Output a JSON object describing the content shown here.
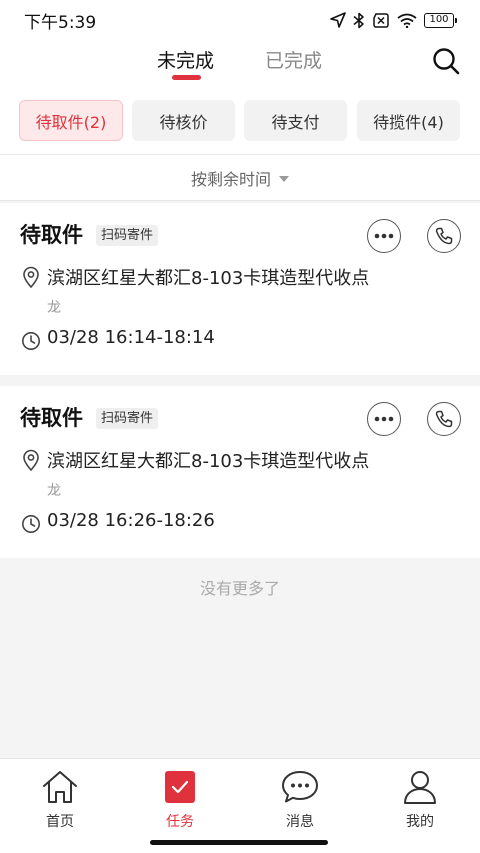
{
  "status_bar": {
    "time": "下午5:39",
    "battery": "100"
  },
  "header": {
    "tabs": [
      {
        "label": "未完成",
        "active": true
      },
      {
        "label": "已完成",
        "active": false
      }
    ]
  },
  "filters": [
    {
      "label": "待取件(2)",
      "active": true
    },
    {
      "label": "待核价",
      "active": false
    },
    {
      "label": "待支付",
      "active": false
    },
    {
      "label": "待揽件(4)",
      "active": false
    }
  ],
  "sort": {
    "label": "按剩余时间"
  },
  "tasks": [
    {
      "status": "待取件",
      "tag": "扫码寄件",
      "address_line1": "滨湖区红星大都汇8-103卡琪造型代收点",
      "address_line2": "龙",
      "time_window": "03/28 16:14-18:14"
    },
    {
      "status": "待取件",
      "tag": "扫码寄件",
      "address_line1": "滨湖区红星大都汇8-103卡琪造型代收点",
      "address_line2": "龙",
      "time_window": "03/28 16:26-18:26"
    }
  ],
  "list_end": "没有更多了",
  "bottom_nav": [
    {
      "label": "首页",
      "icon": "home-icon",
      "active": false
    },
    {
      "label": "任务",
      "icon": "task-check-icon",
      "active": true
    },
    {
      "label": "消息",
      "icon": "message-icon",
      "active": false
    },
    {
      "label": "我的",
      "icon": "user-icon",
      "active": false
    }
  ],
  "colors": {
    "accent": "#e0323c",
    "chip_active_bg": "#fde9ea",
    "page_bg": "#f4f4f4"
  }
}
